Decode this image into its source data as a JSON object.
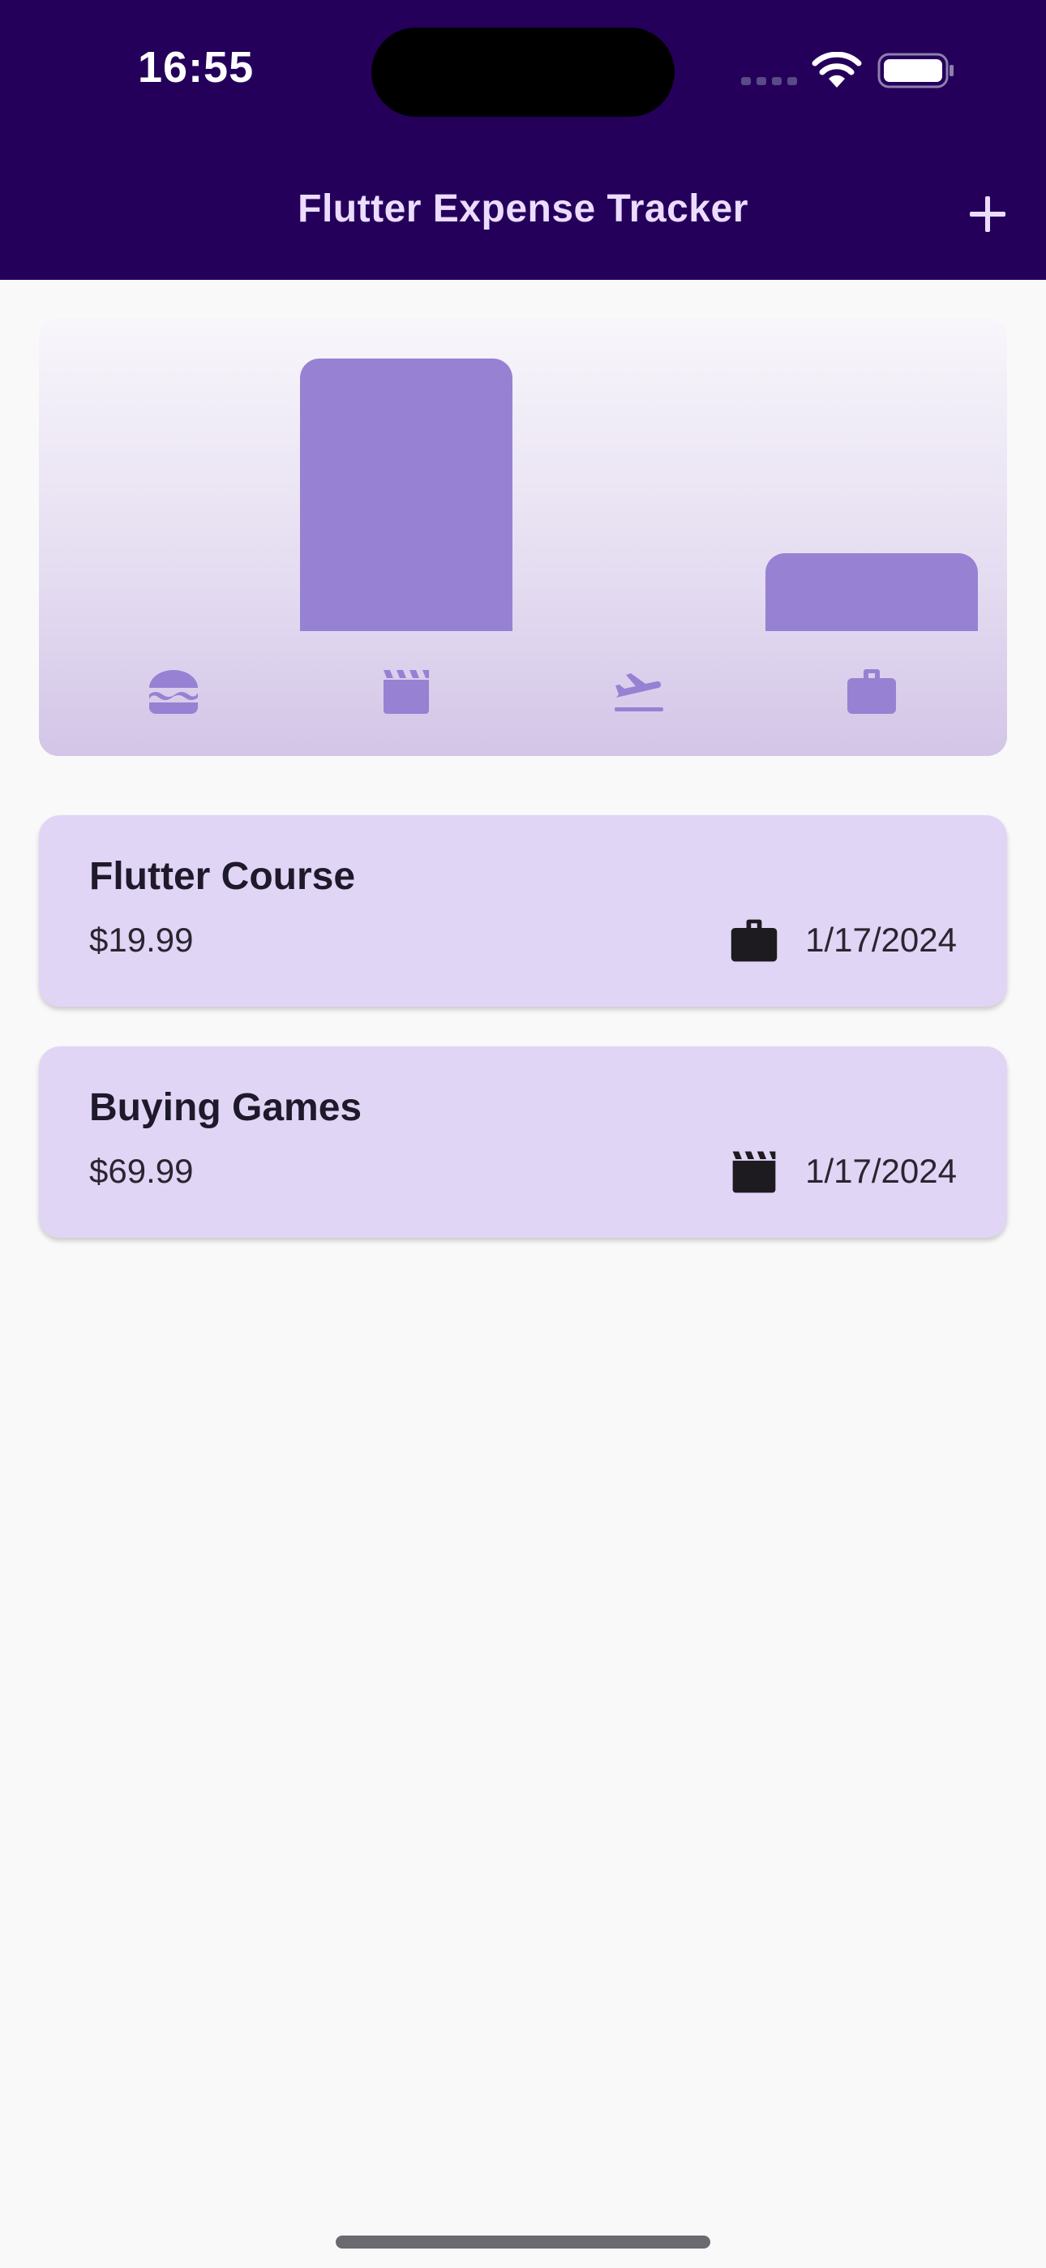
{
  "status_bar": {
    "time": "16:55",
    "icons": [
      "cellular-icon",
      "wifi-icon",
      "battery-icon"
    ]
  },
  "app_bar": {
    "title": "Flutter Expense Tracker",
    "add_icon": "plus-icon"
  },
  "colors": {
    "header": "#25005a",
    "bar": "#9781d3",
    "card": "#e1d5f6"
  },
  "chart_data": {
    "type": "bar",
    "categories": [
      "food",
      "leisure",
      "travel",
      "work"
    ],
    "category_icons": [
      "burger-icon",
      "clapperboard-icon",
      "airplane-icon",
      "briefcase-icon"
    ],
    "values": [
      0,
      69.99,
      0,
      19.99
    ],
    "ylim": [
      0,
      69.99
    ],
    "title": "",
    "xlabel": "",
    "ylabel": ""
  },
  "expenses": [
    {
      "title": "Flutter Course",
      "amount": "$19.99",
      "category_icon": "briefcase-icon",
      "date": "1/17/2024"
    },
    {
      "title": "Buying Games",
      "amount": "$69.99",
      "category_icon": "clapperboard-icon",
      "date": "1/17/2024"
    }
  ]
}
